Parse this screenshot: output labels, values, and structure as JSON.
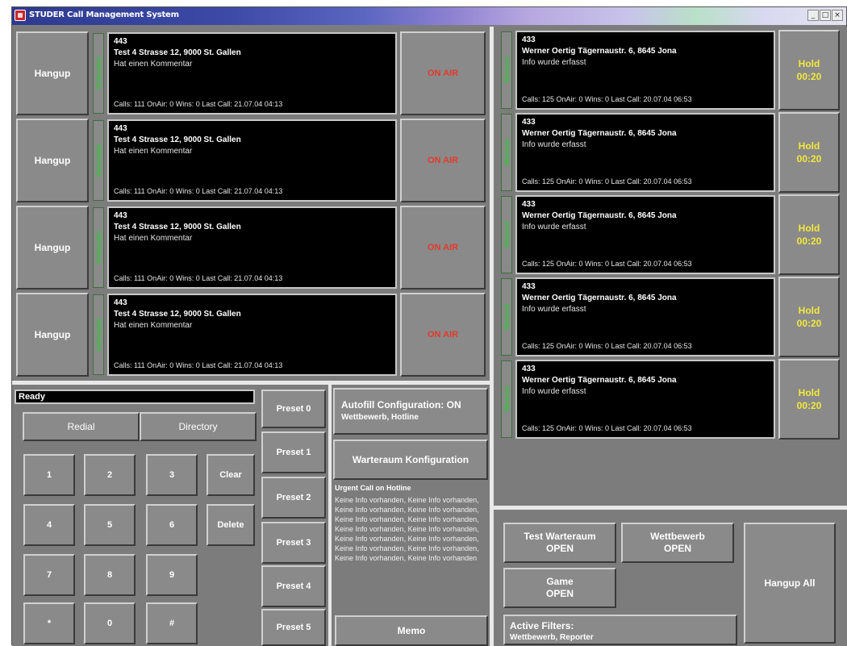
{
  "window": {
    "title": "STUDER Call Management System",
    "controls": [
      "_",
      "□",
      "×"
    ]
  },
  "left_calls": [
    {
      "hangup_label": "Hangup",
      "status": "Verbunden",
      "number": "443",
      "address": "Test 4 Strasse 12, 9000 St. Gallen",
      "comment": "Hat einen Kommentar",
      "stats": "Calls: 111  OnAir: 0  Wins: 0  Last Call: 21.07.04 04:13",
      "onair_label": "ON AIR"
    },
    {
      "hangup_label": "Hangup",
      "status": "Verbunden",
      "number": "443",
      "address": "Test 4 Strasse 12, 9000 St. Gallen",
      "comment": "Hat einen Kommentar",
      "stats": "Calls: 111  OnAir: 0  Wins: 0  Last Call: 21.07.04 04:13",
      "onair_label": "ON AIR"
    },
    {
      "hangup_label": "Hangup",
      "status": "Verbunden",
      "number": "443",
      "address": "Test 4 Strasse 12, 9000 St. Gallen",
      "comment": "Hat einen Kommentar",
      "stats": "Calls: 111  OnAir: 0  Wins: 0  Last Call: 21.07.04 04:13",
      "onair_label": "ON AIR"
    },
    {
      "hangup_label": "Hangup",
      "status": "Verbunden",
      "number": "443",
      "address": "Test 4 Strasse 12, 9000 St. Gallen",
      "comment": "Hat einen Kommentar",
      "stats": "Calls: 111  OnAir: 0  Wins: 0  Last Call: 21.07.04 04:13",
      "onair_label": "ON AIR"
    }
  ],
  "right_calls": [
    {
      "status": "Wartend",
      "number": "433",
      "address": "Werner Oertig Tägernaustr. 6, 8645 Jona",
      "comment": "Info wurde erfasst",
      "stats": "Calls: 125  OnAir: 0  Wins: 0  Last Call: 20.07.04 06:53",
      "hold_label": "Hold",
      "hold_time": "00:20"
    },
    {
      "status": "Wartend",
      "number": "433",
      "address": "Werner Oertig Tägernaustr. 6, 8645 Jona",
      "comment": "Info wurde erfasst",
      "stats": "Calls: 125  OnAir: 0  Wins: 0  Last Call: 20.07.04 06:53",
      "hold_label": "Hold",
      "hold_time": "00:20"
    },
    {
      "status": "Wartend",
      "number": "433",
      "address": "Werner Oertig Tägernaustr. 6, 8645 Jona",
      "comment": "Info wurde erfasst",
      "stats": "Calls: 125  OnAir: 0  Wins: 0  Last Call: 20.07.04 06:53",
      "hold_label": "Hold",
      "hold_time": "00:20"
    },
    {
      "status": "Wartend",
      "number": "433",
      "address": "Werner Oertig Tägernaustr. 6, 8645 Jona",
      "comment": "Info wurde erfasst",
      "stats": "Calls: 125  OnAir: 0  Wins: 0  Last Call: 20.07.04 06:53",
      "hold_label": "Hold",
      "hold_time": "00:20"
    },
    {
      "status": "Wartend",
      "number": "433",
      "address": "Werner Oertig Tägernaustr. 6, 8645 Jona",
      "comment": "Info wurde erfasst",
      "stats": "Calls: 125  OnAir: 0  Wins: 0  Last Call: 20.07.04 06:53",
      "hold_label": "Hold",
      "hold_time": "00:20"
    }
  ],
  "dialer": {
    "status": "Ready",
    "redial_label": "Redial",
    "directory_label": "Directory",
    "keys": [
      "1",
      "2",
      "3",
      "4",
      "5",
      "6",
      "7",
      "8",
      "9",
      "*",
      "0",
      "#"
    ],
    "clear_label": "Clear",
    "delete_label": "Delete"
  },
  "presets": [
    "Preset 0",
    "Preset 1",
    "Preset 2",
    "Preset 3",
    "Preset 4",
    "Preset 5"
  ],
  "config": {
    "autofill_line1": "Autofill Configuration: ON",
    "autofill_line2": "Wettbewerb, Hotline",
    "waiting_room_label": "Warteraum Konfiguration",
    "info_title": "Urgent Call on Hotline",
    "info_body": "Keine Info vorhanden, Keine Info vorhanden, Keine Info vorhanden, Keine Info vorhanden, Keine Info vorhanden, Keine Info vorhanden, Keine Info vorhanden, Keine Info vorhanden, Keine Info vorhanden, Keine Info vorhanden, Keine Info vorhanden, Keine Info vorhanden, Keine Info vorhanden, Keine Info vorhanden",
    "memo_label": "Memo"
  },
  "groups": {
    "test_warteraum": {
      "name": "Test Warteraum",
      "state": "OPEN"
    },
    "wettbewerb": {
      "name": "Wettbewerb",
      "state": "OPEN"
    },
    "game": {
      "name": "Game",
      "state": "OPEN"
    },
    "hangup_all_label": "Hangup All",
    "active_filters_label": "Active Filters:",
    "active_filters_value": "Wettbewerb, Reporter"
  },
  "colors": {
    "panel": "#7c7c7c",
    "onair": "#e23a2a",
    "hold": "#f2e93a",
    "status_green": "#33c43a"
  }
}
